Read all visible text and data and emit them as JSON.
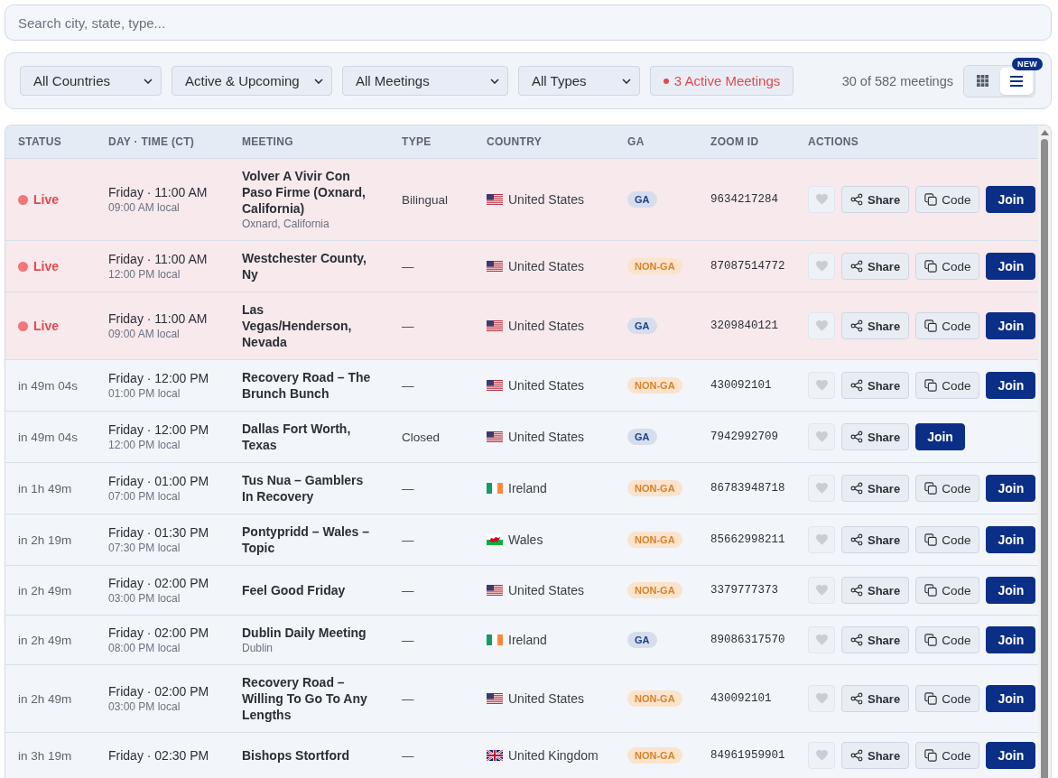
{
  "search": {
    "placeholder": "Search city, state, type..."
  },
  "filters": {
    "selects": [
      {
        "label": "All Countries"
      },
      {
        "label": "Active & Upcoming"
      },
      {
        "label": "All Meetings"
      },
      {
        "label": "All Types"
      }
    ],
    "active_button": {
      "label": "3 Active Meetings"
    },
    "count": "30 of 582 meetings",
    "view_toggle": {
      "badge": "NEW",
      "options": [
        {
          "kind": "grid",
          "selected": false
        },
        {
          "kind": "list",
          "selected": true
        }
      ]
    }
  },
  "table": {
    "columns": [
      "STATUS",
      "DAY · TIME (CT)",
      "MEETING",
      "TYPE",
      "COUNTRY",
      "GA",
      "ZOOM ID",
      "ACTIONS"
    ],
    "rows": [
      {
        "live": true,
        "status": "Live",
        "time": "Friday · 11:00 AM",
        "local": "09:00 AM local",
        "meeting": "Volver A Vivir Con Paso Firme (Oxnard, California)",
        "location": "Oxnard, California",
        "type": "Bilingual",
        "country": {
          "name": "United States",
          "kind": "us"
        },
        "ga": {
          "label": "GA",
          "kind": "ga"
        },
        "zoom_id": "9634217284",
        "favorite": false,
        "actions": [
          {
            "kind": "share",
            "label": "Share"
          },
          {
            "kind": "code",
            "label": "Code"
          },
          {
            "kind": "join",
            "label": "Join"
          }
        ]
      },
      {
        "live": true,
        "status": "Live",
        "time": "Friday · 11:00 AM",
        "local": "12:00 PM local",
        "meeting": "Westchester County, Ny",
        "type": "—",
        "country": {
          "name": "United States",
          "kind": "us"
        },
        "ga": {
          "label": "NON-GA",
          "kind": "non_ga"
        },
        "zoom_id": "87087514772",
        "favorite": false,
        "actions": [
          {
            "kind": "share",
            "label": "Share"
          },
          {
            "kind": "code",
            "label": "Code"
          },
          {
            "kind": "join",
            "label": "Join"
          }
        ]
      },
      {
        "live": true,
        "status": "Live",
        "time": "Friday · 11:00 AM",
        "local": "09:00 AM local",
        "meeting": "Las Vegas/Henderson, Nevada",
        "type": "—",
        "country": {
          "name": "United States",
          "kind": "us"
        },
        "ga": {
          "label": "GA",
          "kind": "ga"
        },
        "zoom_id": "3209840121",
        "favorite": false,
        "actions": [
          {
            "kind": "share",
            "label": "Share"
          },
          {
            "kind": "code",
            "label": "Code"
          },
          {
            "kind": "join",
            "label": "Join"
          }
        ]
      },
      {
        "live": false,
        "status": "in 49m 04s",
        "time": "Friday · 12:00 PM",
        "local": "01:00 PM local",
        "meeting": "Recovery Road – The Brunch Bunch",
        "type": "—",
        "country": {
          "name": "United States",
          "kind": "us"
        },
        "ga": {
          "label": "NON-GA",
          "kind": "non_ga"
        },
        "zoom_id": "430092101",
        "favorite": false,
        "actions": [
          {
            "kind": "share",
            "label": "Share"
          },
          {
            "kind": "code",
            "label": "Code"
          },
          {
            "kind": "join",
            "label": "Join"
          }
        ]
      },
      {
        "live": false,
        "status": "in 49m 04s",
        "time": "Friday · 12:00 PM",
        "local": "12:00 PM local",
        "meeting": "Dallas Fort Worth, Texas",
        "type": "Closed",
        "country": {
          "name": "United States",
          "kind": "us"
        },
        "ga": {
          "label": "GA",
          "kind": "ga"
        },
        "zoom_id": "7942992709",
        "favorite": false,
        "actions": [
          {
            "kind": "share",
            "label": "Share"
          },
          {
            "kind": "join",
            "label": "Join"
          }
        ]
      },
      {
        "live": false,
        "status": "in 1h 49m",
        "time": "Friday · 01:00 PM",
        "local": "07:00 PM local",
        "meeting": "Tus Nua – Gamblers In Recovery",
        "type": "—",
        "country": {
          "name": "Ireland",
          "kind": "ie"
        },
        "ga": {
          "label": "NON-GA",
          "kind": "non_ga"
        },
        "zoom_id": "86783948718",
        "favorite": false,
        "actions": [
          {
            "kind": "share",
            "label": "Share"
          },
          {
            "kind": "code",
            "label": "Code"
          },
          {
            "kind": "join",
            "label": "Join"
          }
        ]
      },
      {
        "live": false,
        "status": "in 2h 19m",
        "time": "Friday · 01:30 PM",
        "local": "07:30 PM local",
        "meeting": "Pontypridd – Wales – Topic",
        "type": "—",
        "country": {
          "name": "Wales",
          "kind": "wales"
        },
        "ga": {
          "label": "NON-GA",
          "kind": "non_ga"
        },
        "zoom_id": "85662998211",
        "favorite": false,
        "actions": [
          {
            "kind": "share",
            "label": "Share"
          },
          {
            "kind": "code",
            "label": "Code"
          },
          {
            "kind": "join",
            "label": "Join"
          }
        ]
      },
      {
        "live": false,
        "status": "in 2h 49m",
        "time": "Friday · 02:00 PM",
        "local": "03:00 PM local",
        "meeting": "Feel Good Friday",
        "type": "—",
        "country": {
          "name": "United States",
          "kind": "us"
        },
        "ga": {
          "label": "NON-GA",
          "kind": "non_ga"
        },
        "zoom_id": "3379777373",
        "favorite": false,
        "actions": [
          {
            "kind": "share",
            "label": "Share"
          },
          {
            "kind": "code",
            "label": "Code"
          },
          {
            "kind": "join",
            "label": "Join"
          }
        ]
      },
      {
        "live": false,
        "status": "in 2h 49m",
        "time": "Friday · 02:00 PM",
        "local": "08:00 PM local",
        "meeting": "Dublin Daily Meeting",
        "location": "Dublin",
        "type": "—",
        "country": {
          "name": "Ireland",
          "kind": "ie"
        },
        "ga": {
          "label": "GA",
          "kind": "ga"
        },
        "zoom_id": "89086317570",
        "favorite": false,
        "actions": [
          {
            "kind": "share",
            "label": "Share"
          },
          {
            "kind": "code",
            "label": "Code"
          },
          {
            "kind": "join",
            "label": "Join"
          }
        ]
      },
      {
        "live": false,
        "status": "in 2h 49m",
        "time": "Friday · 02:00 PM",
        "local": "03:00 PM local",
        "meeting": "Recovery Road – Willing To Go To Any Lengths",
        "type": "—",
        "country": {
          "name": "United States",
          "kind": "us"
        },
        "ga": {
          "label": "NON-GA",
          "kind": "non_ga"
        },
        "zoom_id": "430092101",
        "favorite": false,
        "actions": [
          {
            "kind": "share",
            "label": "Share"
          },
          {
            "kind": "code",
            "label": "Code"
          },
          {
            "kind": "join",
            "label": "Join"
          }
        ]
      },
      {
        "live": false,
        "status": "in 3h 19m",
        "time": "Friday · 02:30 PM",
        "meeting": "Bishops Stortford",
        "type": "—",
        "country": {
          "name": "United Kingdom",
          "kind": "uk"
        },
        "ga": {
          "label": "NON-GA",
          "kind": "non_ga"
        },
        "zoom_id": "84961959901",
        "favorite": false,
        "actions": [
          {
            "kind": "share",
            "label": "Share"
          },
          {
            "kind": "code",
            "label": "Code"
          },
          {
            "kind": "join",
            "label": "Join"
          }
        ]
      }
    ]
  }
}
